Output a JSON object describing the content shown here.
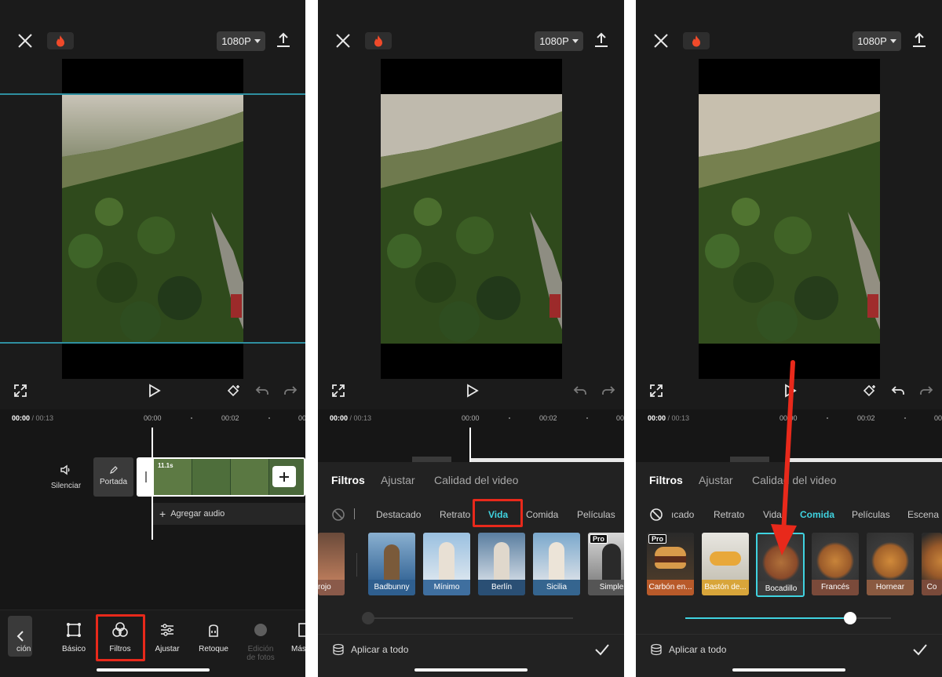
{
  "topbar": {
    "resolution": "1080P",
    "close_icon": "close-icon",
    "fire_icon": "fire-icon",
    "export_icon": "upload-icon"
  },
  "timeline": {
    "current_time": "00:00",
    "total_time": " / 00:13",
    "ruler_ticks": [
      "00:00",
      "00:02",
      "00:0"
    ],
    "clip_duration": "11.1s",
    "mute_label": "Silenciar",
    "cover_label": "Portada",
    "add_audio_label": "Agregar audio"
  },
  "toolbar": {
    "items": [
      {
        "label": "ción",
        "icon": "edit-icon"
      },
      {
        "label": "Básico",
        "icon": "crop-frame-icon"
      },
      {
        "label": "Filtros",
        "icon": "filters-icon"
      },
      {
        "label": "Ajustar",
        "icon": "sliders-icon"
      },
      {
        "label": "Retoque",
        "icon": "retouch-icon"
      },
      {
        "label": "Edición de fotos",
        "icon": "photo-edit-icon"
      },
      {
        "label": "Más",
        "icon": "more-icon"
      }
    ],
    "highlighted": "Filtros"
  },
  "filter_panel": {
    "tabs": [
      "Filtros",
      "Ajustar",
      "Calidad del video"
    ],
    "apply_all_label": "Aplicar a todo",
    "panel2": {
      "categories": [
        "Destacado",
        "Retrato",
        "Vida",
        "Comida",
        "Películas"
      ],
      "active_category": "Vida",
      "filters": [
        {
          "label": "rojo",
          "pro": false
        },
        {
          "label": "Badbunny",
          "pro": false
        },
        {
          "label": "Mínimo",
          "pro": false
        },
        {
          "label": "Berlín",
          "pro": false
        },
        {
          "label": "Sicilia",
          "pro": false
        },
        {
          "label": "Simple",
          "pro": true
        }
      ],
      "intensity": 0
    },
    "panel3": {
      "categories": [
        "ıcado",
        "Retrato",
        "Vida",
        "Comida",
        "Películas",
        "Escena n"
      ],
      "active_category": "Comida",
      "filters": [
        {
          "label": "Carbón en...",
          "pro": true
        },
        {
          "label": "Bastón de...",
          "pro": false
        },
        {
          "label": "Bocadillo",
          "pro": false
        },
        {
          "label": "Francés",
          "pro": false
        },
        {
          "label": "Hornear",
          "pro": false
        },
        {
          "label": "Co",
          "pro": false
        }
      ],
      "selected_filter": "Bocadillo",
      "intensity": 0.8
    },
    "pro_badge": "Pro"
  },
  "colors": {
    "accent": "#3fd3e0",
    "highlight_red": "#e8291b",
    "panel_bg": "#1b1b1b"
  }
}
